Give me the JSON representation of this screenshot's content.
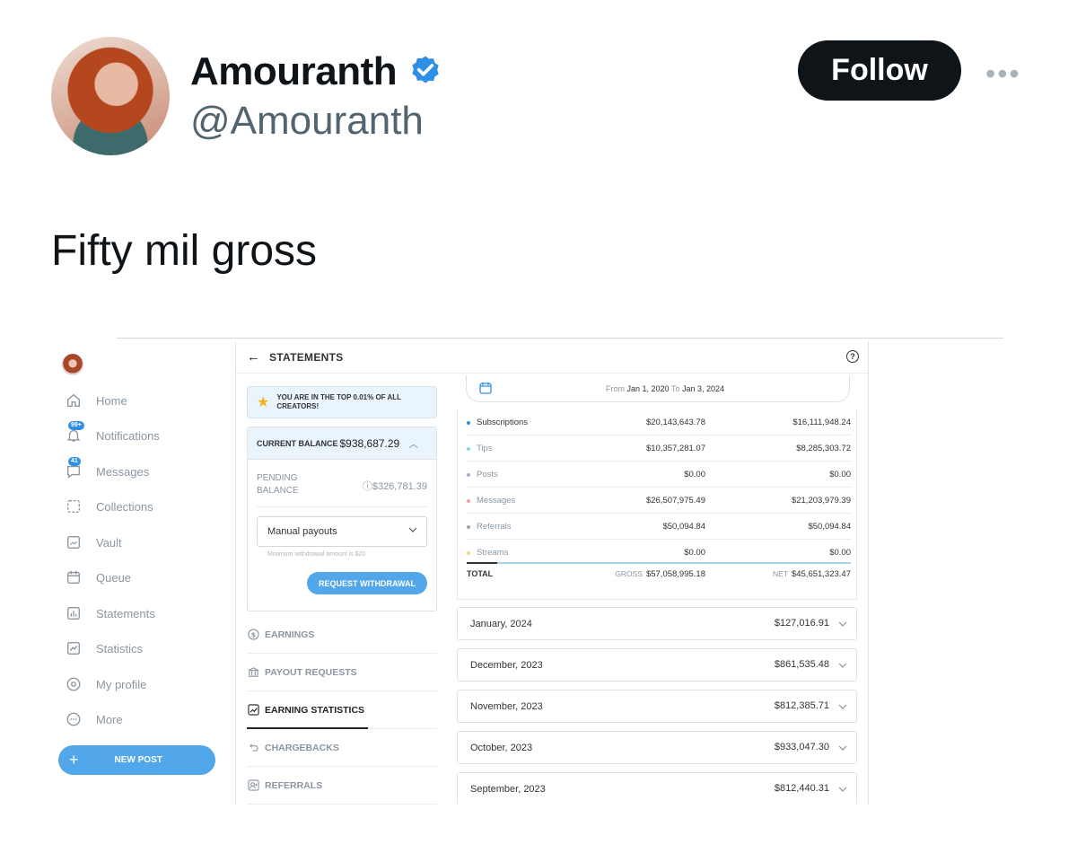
{
  "tweet": {
    "author_name": "Amouranth",
    "handle": "@Amouranth",
    "follow_label": "Follow",
    "more_label": "•••",
    "text": "Fifty mil gross"
  },
  "colors": {
    "verified_blue": "#2f8fe4",
    "follow_bg": "#0f1419",
    "accent_blue": "#52a7ea"
  },
  "sidebar": {
    "items": [
      {
        "label": "Home",
        "icon": "home-icon"
      },
      {
        "label": "Notifications",
        "icon": "bell-icon",
        "badge": "99+"
      },
      {
        "label": "Messages",
        "icon": "message-icon",
        "badge": "41"
      },
      {
        "label": "Collections",
        "icon": "collections-icon"
      },
      {
        "label": "Vault",
        "icon": "vault-icon"
      },
      {
        "label": "Queue",
        "icon": "calendar-icon"
      },
      {
        "label": "Statements",
        "icon": "statements-icon"
      },
      {
        "label": "Statistics",
        "icon": "statistics-icon"
      },
      {
        "label": "My profile",
        "icon": "profile-icon"
      },
      {
        "label": "More",
        "icon": "more-icon"
      }
    ],
    "new_post_label": "NEW POST"
  },
  "panel": {
    "title": "STATEMENTS",
    "top_banner": "YOU ARE IN THE TOP 0.01% OF ALL CREATORS!",
    "current_balance_label": "CURRENT BALANCE",
    "current_balance_value": "$938,687.29",
    "pending_label": "PENDING BALANCE",
    "pending_value": "$326,781.39",
    "payout_select_value": "Manual payouts",
    "min_note": "Minimum withdrawal amount is $20",
    "request_button": "REQUEST WITHDRAWAL",
    "menu": [
      {
        "label": "EARNINGS",
        "active": false
      },
      {
        "label": "PAYOUT REQUESTS",
        "active": false
      },
      {
        "label": "EARNING STATISTICS",
        "active": true
      },
      {
        "label": "CHARGEBACKS",
        "active": false
      },
      {
        "label": "REFERRALS",
        "active": false
      }
    ]
  },
  "date_range": {
    "from_label": "From",
    "from": "Jan 1, 2020",
    "to_label": "To",
    "to": "Jan 3, 2024"
  },
  "earnings_table": {
    "rows": [
      {
        "name": "Subscriptions",
        "gross": "$20,143,643.78",
        "net": "$16,111,948.24",
        "dot_color": "#2f8fe4"
      },
      {
        "name": "Tips",
        "gross": "$10,357,281.07",
        "net": "$8,285,303.72",
        "dot_color": "#8fd3e8"
      },
      {
        "name": "Posts",
        "gross": "$0.00",
        "net": "$0.00",
        "dot_color": "#b8a6d9"
      },
      {
        "name": "Messages",
        "gross": "$26,507,975.49",
        "net": "$21,203,979.39",
        "dot_color": "#f4a0a0"
      },
      {
        "name": "Referrals",
        "gross": "$50,094.84",
        "net": "$50,094.84",
        "dot_color": "#9aa6b2"
      },
      {
        "name": "Streams",
        "gross": "$0.00",
        "net": "$0.00",
        "dot_color": "#f5d37a"
      }
    ],
    "total_label": "TOTAL",
    "gross_tag": "GROSS",
    "net_tag": "NET",
    "total_gross": "$57,058,995.18",
    "total_net": "$45,651,323.47"
  },
  "months": [
    {
      "month": "January, 2024",
      "amount": "$127,016.91"
    },
    {
      "month": "December, 2023",
      "amount": "$861,535.48"
    },
    {
      "month": "November, 2023",
      "amount": "$812,385.71"
    },
    {
      "month": "October, 2023",
      "amount": "$933,047.30"
    },
    {
      "month": "September, 2023",
      "amount": "$812,440.31"
    }
  ]
}
